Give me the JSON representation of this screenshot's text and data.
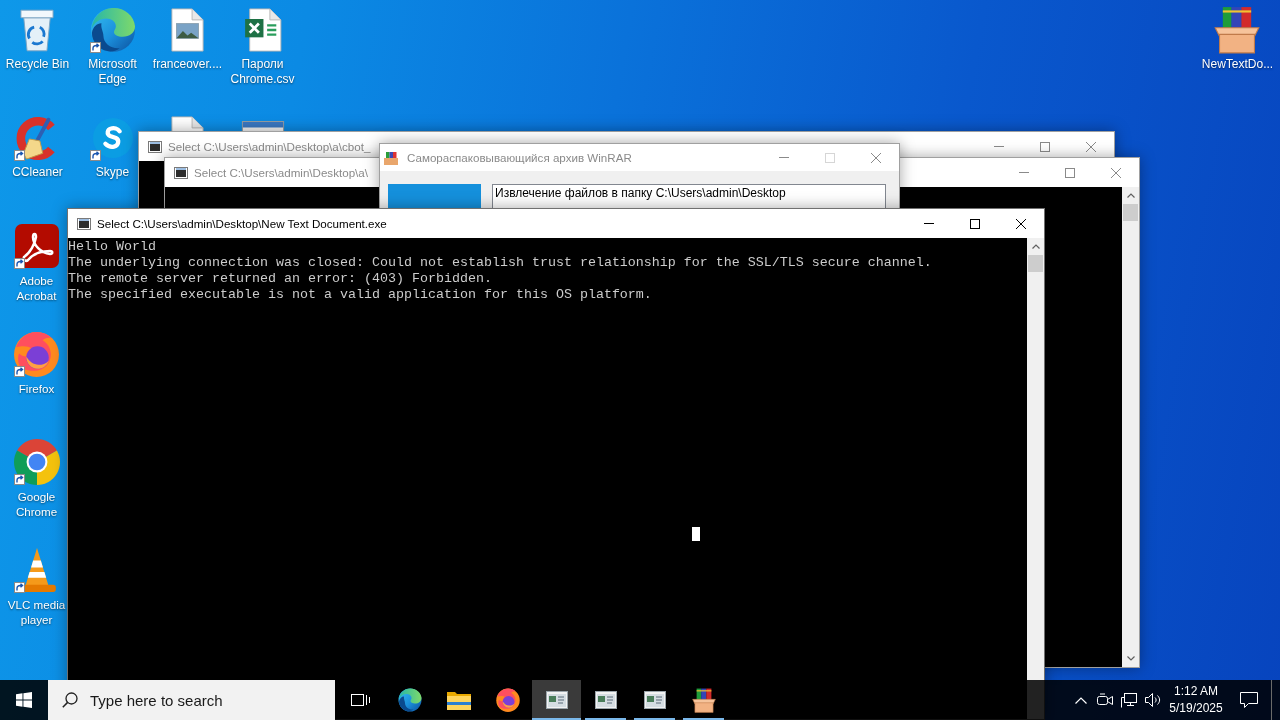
{
  "desktop": {
    "icon_rows": [
      [
        {
          "kind": "recycle-bin",
          "label": "Recycle Bin",
          "shortcut": false
        },
        {
          "kind": "edge",
          "label": "Microsoft Edge",
          "shortcut": true
        },
        {
          "kind": "image-file",
          "label": "franceover....",
          "shortcut": false
        },
        {
          "kind": "spreadsheet-file",
          "label": "Пароли Chrome.csv",
          "shortcut": false
        }
      ],
      [
        {
          "kind": "ccleaner",
          "label": "CCleaner",
          "shortcut": true
        },
        {
          "kind": "skype",
          "label": "Skype",
          "shortcut": true
        },
        {
          "kind": "blank-file"
        },
        {
          "kind": "app-window"
        }
      ]
    ],
    "left_column": [
      {
        "kind": "acrobat",
        "label": "Adobe Acrobat",
        "shortcut": true
      },
      {
        "kind": "firefox",
        "label": "Firefox",
        "shortcut": true
      },
      {
        "kind": "chrome",
        "label": "Google Chrome",
        "shortcut": true
      },
      {
        "kind": "vlc",
        "label": "VLC media player",
        "shortcut": true
      }
    ],
    "right_icons": [
      {
        "kind": "winrar-archive",
        "label": "NewTextDo...",
        "shortcut": false
      }
    ]
  },
  "windows": [
    {
      "kind": "console",
      "title": "Select C:\\Users\\admin\\Desktop\\a\\cbot_",
      "active": false,
      "maximize_disabled": false
    },
    {
      "kind": "console",
      "title": "Select C:\\Users\\admin\\Desktop\\a\\",
      "active": false,
      "maximize_disabled": false
    },
    {
      "kind": "sfx-dialog",
      "title": "Самораспаковывающийся архив WinRAR",
      "active": false,
      "maximize_disabled": true,
      "log": [
        "Извлечение файлов в папку C:\\Users\\admin\\Desktop"
      ]
    },
    {
      "kind": "console",
      "title": "Select C:\\Users\\admin\\Desktop\\New Text Document.exe",
      "active": true,
      "maximize_disabled": false,
      "lines": [
        "Hello World",
        "The underlying connection was closed: Could not establish trust relationship for the SSL/TLS secure channel.",
        "The remote server returned an error: (403) Forbidden.",
        "The specified executable is not a valid application for this OS platform."
      ]
    }
  ],
  "taskbar": {
    "search": {
      "placeholder": "Type here to search"
    },
    "apps": [
      {
        "kind": "task-view",
        "running": false,
        "selected": false
      },
      {
        "kind": "edge",
        "running": false,
        "selected": false
      },
      {
        "kind": "file-explorer",
        "running": false,
        "selected": false
      },
      {
        "kind": "firefox",
        "running": false,
        "selected": false
      },
      {
        "kind": "console",
        "running": true,
        "selected": true
      },
      {
        "kind": "console",
        "running": true,
        "selected": false
      },
      {
        "kind": "console",
        "running": true,
        "selected": false
      },
      {
        "kind": "winrar",
        "running": true,
        "selected": false
      }
    ],
    "tray": [
      {
        "kind": "chevron"
      },
      {
        "kind": "meet-now"
      },
      {
        "kind": "network"
      },
      {
        "kind": "volume"
      }
    ],
    "clock": {
      "time": "1:12 AM",
      "date": "5/19/2025"
    }
  }
}
